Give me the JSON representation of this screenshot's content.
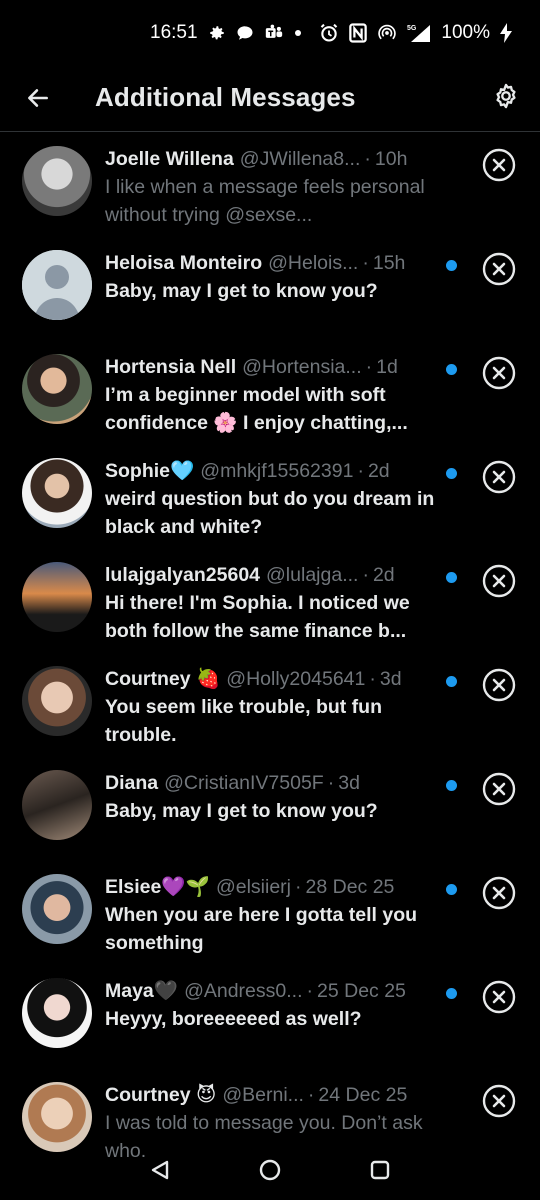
{
  "status_bar": {
    "time": "16:51",
    "network": "5G",
    "battery": "100%",
    "icons": [
      "gear-icon",
      "chat-bubble-icon",
      "teams-icon",
      "dot-icon",
      "alarm-icon",
      "nfc-icon",
      "hotspot-icon",
      "signal-icon",
      "charging-icon"
    ]
  },
  "header": {
    "title": "Additional Messages",
    "back_icon": "back-arrow-icon",
    "settings_icon": "settings-gear-icon"
  },
  "colors": {
    "background": "#000000",
    "primary_text": "#e7e9ea",
    "secondary_text": "#71767b",
    "accent_blue": "#1d9bf0",
    "divider": "#2f3336"
  },
  "messages": [
    {
      "name": "Joelle Willena",
      "handle": "@JWillena8...",
      "time": "10h",
      "text": "I like when a message feels personal without trying @sexse...",
      "unread": false
    },
    {
      "name": "Heloisa Monteiro",
      "handle": "@Helois...",
      "time": "15h",
      "text": "Baby, may I get to know you?",
      "unread": true
    },
    {
      "name": "Hortensia Nell",
      "handle": "@Hortensia...",
      "time": "1d",
      "text": "I’m a beginner model with soft confidence 🌸 I enjoy chatting,...",
      "unread": true
    },
    {
      "name": "Sophie🩵",
      "handle": "@mhkjf15562391",
      "time": "2d",
      "text": "weird question but do you dream in black and white?",
      "unread": true
    },
    {
      "name": "lulajgalyan25604",
      "handle": "@lulajga...",
      "time": "2d",
      "text": "Hi there! I'm Sophia. I noticed we both follow the same finance b...",
      "unread": true
    },
    {
      "name": "Courtney 🍓",
      "handle": "@Holly2045641",
      "time": "3d",
      "text": "You seem like trouble, but fun trouble.",
      "unread": true
    },
    {
      "name": "Diana",
      "handle": "@CristianIV7505F",
      "time": "3d",
      "text": "Baby, may I get to know you?",
      "unread": true
    },
    {
      "name": "Elsiee💜🌱",
      "handle": "@elsiierj",
      "time": "28 Dec 25",
      "text": "When you are here I gotta tell you something",
      "unread": true
    },
    {
      "name": "Maya🖤",
      "handle": "@Andress0...",
      "time": "25 Dec 25",
      "text": "Heyyy, boreeeeeed as well?",
      "unread": true
    },
    {
      "name": "Courtney 😈",
      "handle": "@Berni...",
      "time": "24 Dec 25",
      "text": "I was told to message you. Don’t ask who.",
      "unread": false
    }
  ],
  "nav_bar": {
    "icons": [
      "nav-back-icon",
      "nav-home-icon",
      "nav-recents-icon"
    ]
  }
}
